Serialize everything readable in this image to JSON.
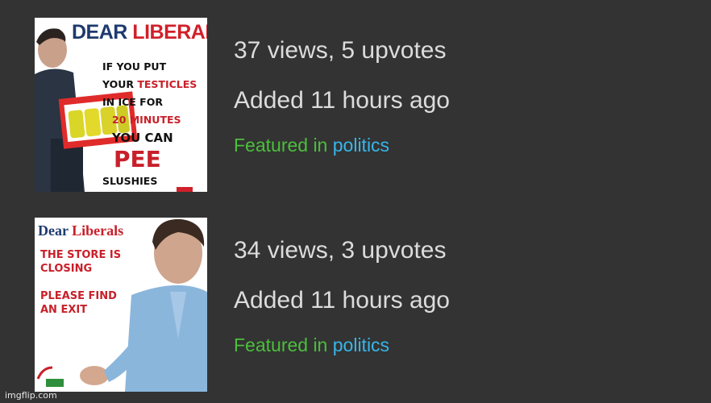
{
  "items": [
    {
      "stats": "37 views, 5 upvotes",
      "added": "Added 11 hours ago",
      "featured_prefix": "Featured in",
      "stream": "politics",
      "meme": {
        "title_a": "DEAR ",
        "title_b": "LIBERALS",
        "line1": "IF YOU PUT",
        "line2_a": "YOUR ",
        "line2_b": "TESTICLES",
        "line3": "IN ICE FOR",
        "line4": "20 MINUTES",
        "line5": "YOU CAN",
        "line6": "PEE",
        "line7": "SLUSHIES"
      }
    },
    {
      "stats": "34 views, 3 upvotes",
      "added": "Added 11 hours ago",
      "featured_prefix": "Featured in",
      "stream": "politics",
      "meme": {
        "title_a": "Dear ",
        "title_b": "Liberals",
        "line1": "THE STORE IS",
        "line2": "CLOSING",
        "line3": "PLEASE FIND",
        "line4": "AN EXIT"
      }
    }
  ],
  "watermark": "imgflip.com",
  "colors": {
    "background": "#333333",
    "text": "#dcdcdc",
    "featured": "#4bbf3c",
    "stream_link": "#36b6ea"
  }
}
